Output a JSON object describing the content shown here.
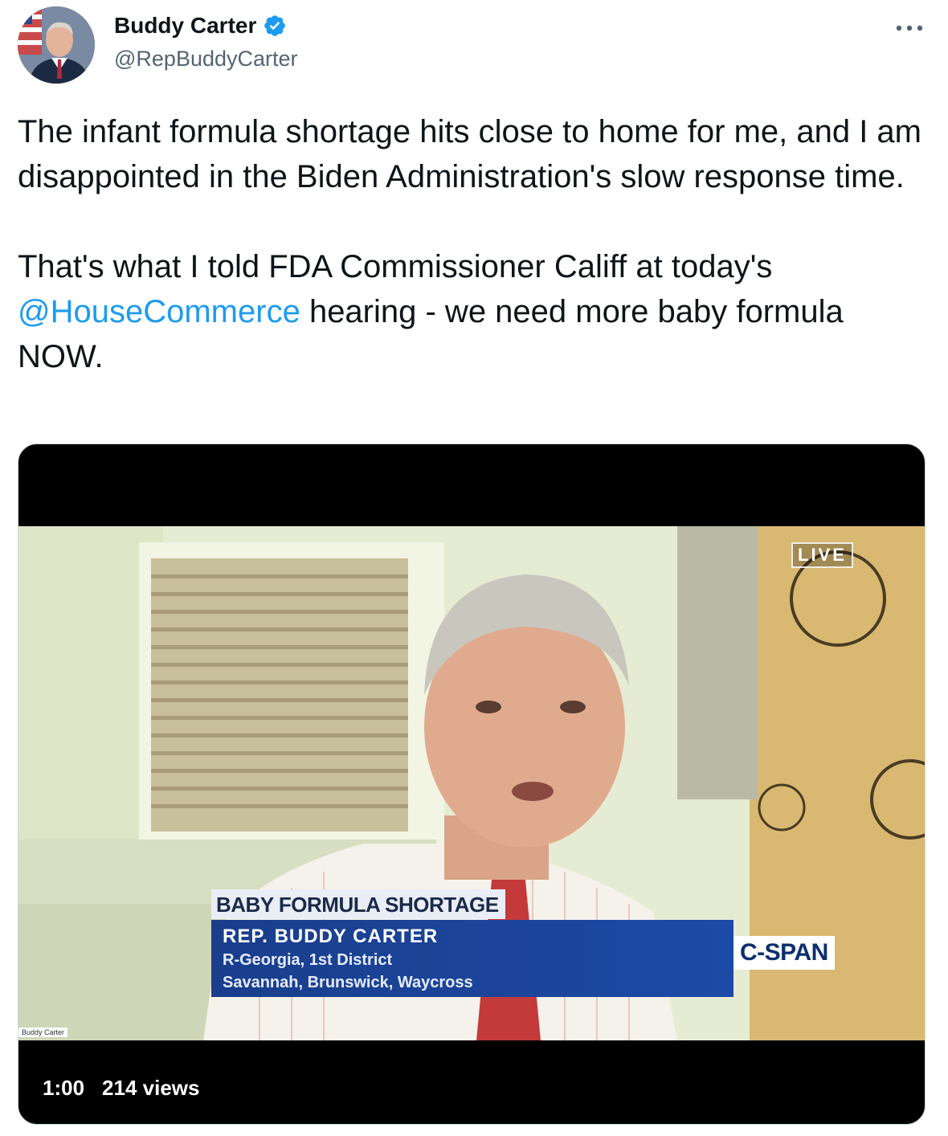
{
  "author": {
    "name": "Buddy Carter",
    "handle": "@RepBuddyCarter",
    "verified_icon": "verified-badge-icon",
    "accent_color": "#1d9bf0"
  },
  "tweet": {
    "paragraph1": "The infant formula shortage hits close to home for me, and I am disappointed in the Biden Administration's slow response time.",
    "paragraph2_before": "That's what I told FDA Commissioner Califf at today's ",
    "mention": "@HouseCommerce",
    "paragraph2_after": " hearing - we need more baby formula NOW."
  },
  "video": {
    "live_label": "LIVE",
    "banner_title": "BABY FORMULA SHORTAGE",
    "lower_third_name": "REP. BUDDY CARTER",
    "lower_third_line1": "R-Georgia, 1st District",
    "lower_third_line2": "Savannah, Brunswick, Waycross",
    "network_logo": "C-SPAN",
    "participant_name_tag": "Buddy Carter",
    "duration": "1:00",
    "views": "214 views"
  }
}
